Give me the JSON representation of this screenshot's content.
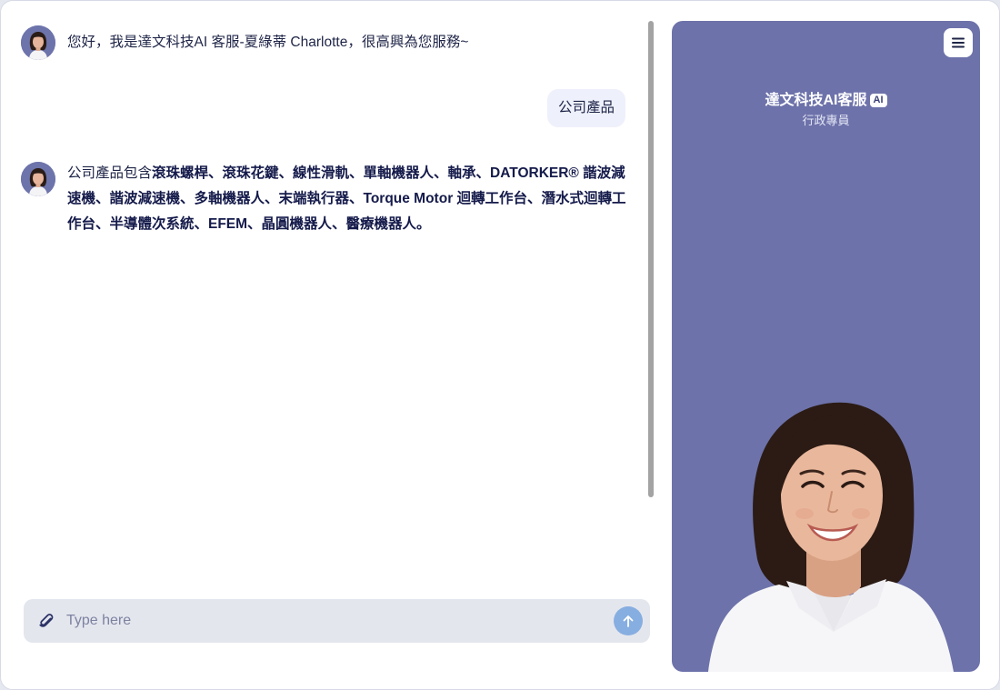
{
  "messages": {
    "greeting": "您好，我是達文科技AI 客服-夏綠蒂 Charlotte，很高興為您服務~",
    "user_query": "公司產品",
    "reply_prefix": "公司產品包含",
    "reply_products": "滾珠螺桿、滾珠花鍵、線性滑軌、單軸機器人、軸承、DATORKER® 諧波減速機、諧波減速機、多軸機器人、末端執行器、Torque Motor 迴轉工作台、潛水式迴轉工作台、半導體次系統、EFEM、晶圓機器人、醫療機器人。"
  },
  "input": {
    "placeholder": "Type here",
    "value": ""
  },
  "agent": {
    "name": "達文科技AI客服",
    "badge": "AI",
    "role": "行政專員"
  },
  "icons": {
    "attach": "paperclip-icon",
    "send": "arrow-up-icon",
    "menu": "hamburger-menu-icon",
    "avatar": "agent-avatar"
  },
  "colors": {
    "panel_bg": "#6d72aa",
    "user_bubble": "#eef0fb",
    "input_bg": "#e4e6ee",
    "send_button": "#87aee0",
    "text": "#1f2547"
  }
}
